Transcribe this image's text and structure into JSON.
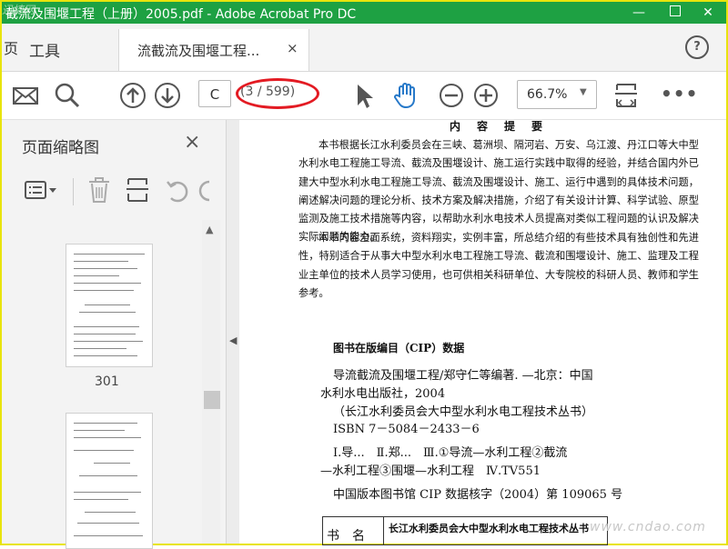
{
  "window": {
    "title": "截流及围堰工程（上册）2005.pdf - Adobe Acrobat Pro DC",
    "watermark_top": "迅捷网"
  },
  "tabs": {
    "left_stub": "页",
    "tools": "工具",
    "doc_title": "流截流及围堰工程...",
    "close": "×",
    "help": "?"
  },
  "toolbar": {
    "page_input": "C",
    "page_count": "(3 / 599)",
    "zoom": "66.7%",
    "more": "•••"
  },
  "panel": {
    "title": "页面缩略图",
    "close": "×",
    "thumb_label": "301"
  },
  "document": {
    "heading_fragment": "内容提要",
    "para1": "本书根据长江水利委员会在三峡、葛洲坝、隔河岩、万安、乌江渡、丹江口等大中型水利水电工程施工导流、截流及围堰设计、施工运行实践中取得的经验，并结合国内外已建大中型水利水电工程施工导流、截流及围堰设计、施工、运行中遇到的具体技术问题，阐述解决问题的理论分析、技术方案及解决措施，介绍了有关设计计算、科学试验、原型监测及施工技术措施等内容，以帮助水利水电技术人员提高对类似工程问题的认识及解决实际问题的能力。",
    "para2": "本书内容全面系统，资料翔实，实例丰富，所总结介绍的有些技术具有独创性和先进性，特别适合于从事大中型水利水电工程施工导流、截流和围堰设计、施工、监理及工程业主单位的技术人员学习使用，也可供相关科研单位、大专院校的科研人员、教师和学生参考。",
    "cip_title": "图书在版编目（CIP）数据",
    "cip_line1": "导流截流及围堰工程/郑守仁等编著. —北京：中国",
    "cip_line2": "水利水电出版社，2004",
    "cip_line3": "（长江水利委员会大中型水利水电工程技术丛书）",
    "cip_line4": "ISBN 7－5084－2433－6",
    "cip_line5": "Ⅰ.导...　Ⅱ.郑...　Ⅲ.①导流—水利工程②截流",
    "cip_line6": "—水利工程③围堰—水利工程　Ⅳ.TV551",
    "cip_line7": "中国版本图书馆 CIP 数据核字（2004）第 109065 号",
    "table_cell_a": "书　名",
    "table_cell_b": "长江水利委员会大中型水利水电工程技术丛书",
    "watermark": "www.cndao.com"
  },
  "colors": {
    "titlebar": "#1ea143",
    "frame": "#e8e40c",
    "accent_hand": "#2779c9",
    "annotation": "#e31b23"
  },
  "icons": [
    "mail-icon",
    "search-icon",
    "arrow-up-circle-icon",
    "arrow-down-circle-icon",
    "pointer-icon",
    "hand-icon",
    "zoom-out-icon",
    "zoom-in-icon",
    "fit-page-icon",
    "more-icon",
    "options-icon",
    "delete-icon",
    "extract-icon",
    "undo-icon",
    "redo-icon"
  ]
}
